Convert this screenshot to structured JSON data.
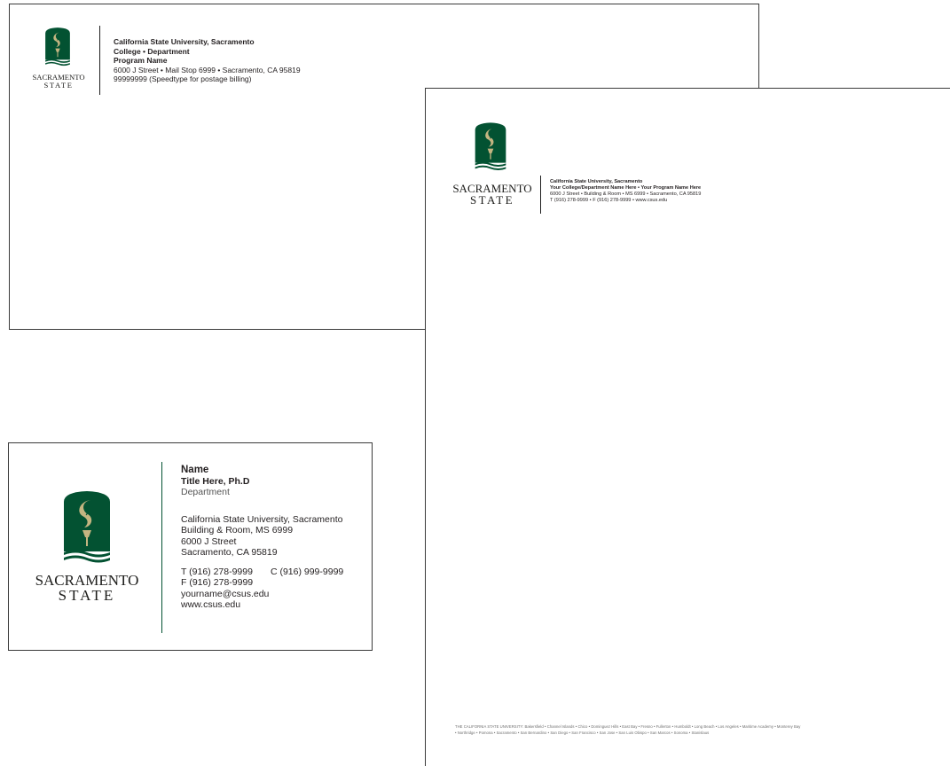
{
  "brand": {
    "green": "#035232",
    "gold": "#c4b581",
    "wordmark_line1": "SACRAMENTO",
    "wordmark_line2": "STATE"
  },
  "envelope": {
    "line1": "California State University, Sacramento",
    "line2": "College • Department",
    "line3": "Program Name",
    "line4": "6000 J Street  •  Mail Stop 6999  •  Sacramento, CA  95819",
    "line5": "99999999 (Speedtype for postage billing)"
  },
  "letterhead": {
    "line1": "California State University, Sacramento",
    "line2": "Your College/Department Name Here  •  Your Program Name Here",
    "line3": "6000 J Street  •  Building & Room  •  MS 6999  •  Sacramento, CA  95819",
    "line4": "T (916) 278-9999  • F (916) 278-9999  •  www.csus.edu",
    "footer_prefix": "THE CALIFORNIA STATE UNIVERSITY:",
    "footer_line1": "Bakersfield • Channel Islands • Chico • Dominguez Hills • East Bay • Fresno • Fullerton • Humboldt • Long Beach • Los Angeles • Maritime Academy • Monterey Bay",
    "footer_line2": "• Northridge • Pomona • Sacramento • San Bernardino • San Diego • San Francisco • San Jose • San Luis Obispo • San Marcos • Sonoma • Stanislaus"
  },
  "card": {
    "name": "Name",
    "title": "Title Here, Ph.D",
    "department": "Department",
    "addr1": "California State University, Sacramento",
    "addr2": "Building & Room, MS 6999",
    "addr3": "6000 J Street",
    "addr4": "Sacramento, CA 95819",
    "phone": "T (916) 278-9999",
    "cell": "C (916) 999-9999",
    "fax": "F (916) 278-9999",
    "email": "yourname@csus.edu",
    "web": "www.csus.edu"
  }
}
